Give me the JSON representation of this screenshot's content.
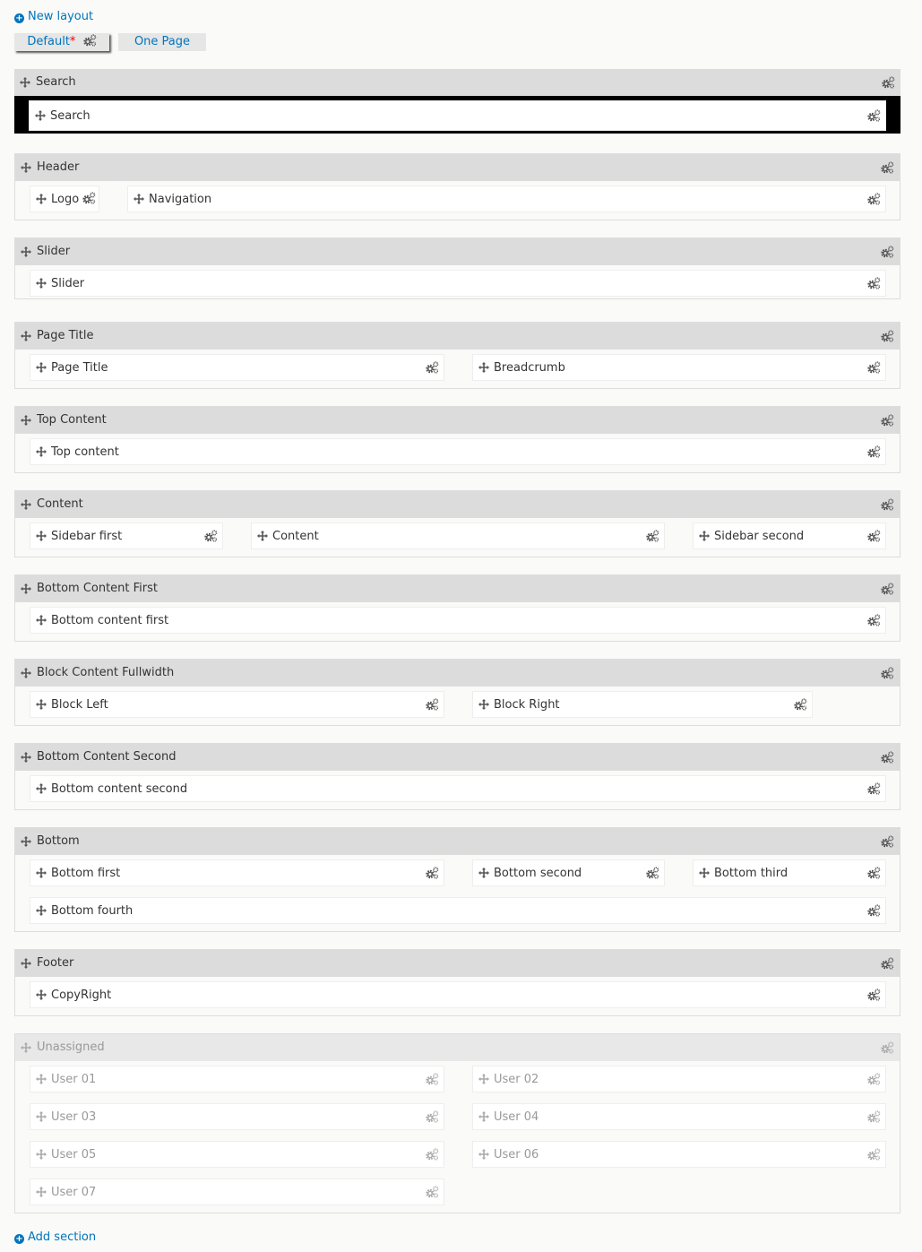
{
  "new_layout_label": "New layout",
  "add_section_label": "Add section",
  "tabs": [
    {
      "label": "Default",
      "marker": "*"
    },
    {
      "label": "One Page"
    }
  ],
  "regions": [
    {
      "title": "Search",
      "blocks": [
        "Search"
      ]
    },
    {
      "title": "Header",
      "blocks": [
        "Logo",
        "Navigation"
      ]
    },
    {
      "title": "Slider",
      "blocks": [
        "Slider"
      ]
    },
    {
      "title": "Page Title",
      "blocks": [
        "Page Title",
        "Breadcrumb"
      ]
    },
    {
      "title": "Top Content",
      "blocks": [
        "Top content"
      ]
    },
    {
      "title": "Content",
      "blocks": [
        "Sidebar first",
        "Content",
        "Sidebar second"
      ]
    },
    {
      "title": "Bottom Content First",
      "blocks": [
        "Bottom content first"
      ]
    },
    {
      "title": "Block Content Fullwidth",
      "blocks": [
        "Block Left",
        "Block Right"
      ]
    },
    {
      "title": "Bottom Content Second",
      "blocks": [
        "Bottom content second"
      ]
    },
    {
      "title": "Bottom",
      "blocks": [
        "Bottom first",
        "Bottom second",
        "Bottom third",
        "Bottom fourth"
      ]
    },
    {
      "title": "Footer",
      "blocks": [
        "CopyRight"
      ]
    },
    {
      "title": "Unassigned",
      "blocks": [
        "User 01",
        "User 02",
        "User 03",
        "User 04",
        "User 05",
        "User 06",
        "User 07"
      ]
    }
  ],
  "icons": {
    "move": "move-arrows-icon",
    "settings": "gears-icon",
    "add": "plus-circle-icon"
  },
  "colors": {
    "link": "#0074bd",
    "region_header": "#dcdcdc",
    "required": "#e00000"
  }
}
